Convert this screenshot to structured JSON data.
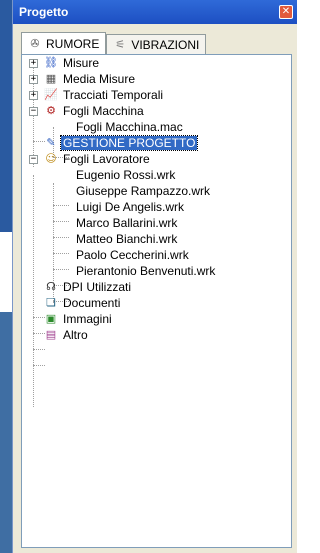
{
  "panel": {
    "title": "Progetto",
    "close_glyph": "✕"
  },
  "tabs": [
    {
      "label": "RUMORE",
      "icon": "ear-icon",
      "active": true
    },
    {
      "label": "VIBRAZIONI",
      "icon": "vibration-icon",
      "active": false
    }
  ],
  "tree": {
    "items": [
      {
        "label": "Misure",
        "icon": "network-icon",
        "expander": "+"
      },
      {
        "label": "Media Misure",
        "icon": "calculator-icon",
        "expander": "+"
      },
      {
        "label": "Tracciati Temporali",
        "icon": "graph-icon",
        "expander": "+"
      },
      {
        "label": "Fogli Macchina",
        "icon": "machine-icon",
        "expander": "−"
      },
      {
        "label": "Fogli Macchina.mac"
      },
      {
        "label": "GESTIONE PROGETTO",
        "icon": "project-icon",
        "selected": true
      },
      {
        "label": "Fogli Lavoratore",
        "icon": "worker-icon",
        "expander": "−"
      },
      {
        "label": "Eugenio Rossi.wrk"
      },
      {
        "label": "Giuseppe Rampazzo.wrk"
      },
      {
        "label": "Luigi De Angelis.wrk"
      },
      {
        "label": "Marco Ballarini.wrk"
      },
      {
        "label": "Matteo Bianchi.wrk"
      },
      {
        "label": "Paolo Ceccherini.wrk"
      },
      {
        "label": "Pierantonio Benvenuti.wrk"
      },
      {
        "label": "DPI Utilizzati",
        "icon": "headphones-icon"
      },
      {
        "label": "Documenti",
        "icon": "documents-icon"
      },
      {
        "label": "Immagini",
        "icon": "images-icon"
      },
      {
        "label": "Altro",
        "icon": "other-icon"
      }
    ]
  }
}
